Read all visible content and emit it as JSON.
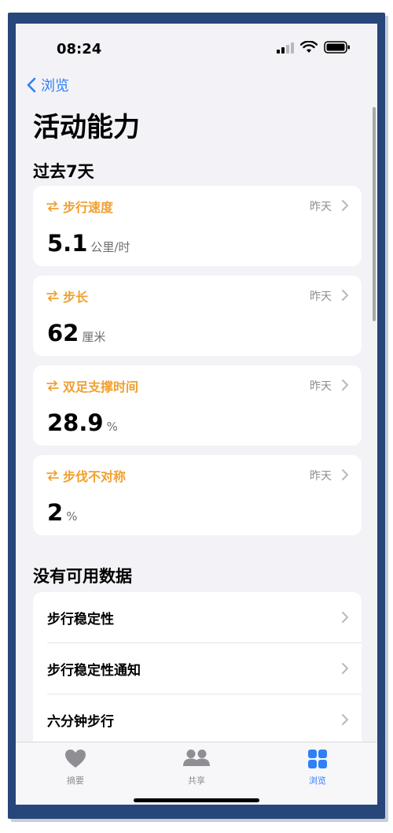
{
  "status": {
    "time": "08:24"
  },
  "nav": {
    "back_label": "浏览"
  },
  "page": {
    "title": "活动能力"
  },
  "section_recent": {
    "title": "过去7天"
  },
  "cards": [
    {
      "title": "步行速度",
      "date": "昨天",
      "value": "5.1",
      "unit": "公里/时"
    },
    {
      "title": "步长",
      "date": "昨天",
      "value": "62",
      "unit": "厘米"
    },
    {
      "title": "双足支撑时间",
      "date": "昨天",
      "value": "28.9",
      "unit": "%"
    },
    {
      "title": "步伐不对称",
      "date": "昨天",
      "value": "2",
      "unit": "%"
    }
  ],
  "section_nodata": {
    "title": "没有可用数据"
  },
  "nodata_items": [
    {
      "label": "步行稳定性"
    },
    {
      "label": "步行稳定性通知"
    },
    {
      "label": "六分钟步行"
    }
  ],
  "tabs": [
    {
      "label": "摘要",
      "icon": "heart-icon",
      "active": false
    },
    {
      "label": "共享",
      "icon": "people-icon",
      "active": false
    },
    {
      "label": "浏览",
      "icon": "grid-icon",
      "active": true
    }
  ],
  "colors": {
    "accent": "#2f7ff5",
    "mobility": "#f0a030",
    "inactive": "#8e8e93"
  }
}
